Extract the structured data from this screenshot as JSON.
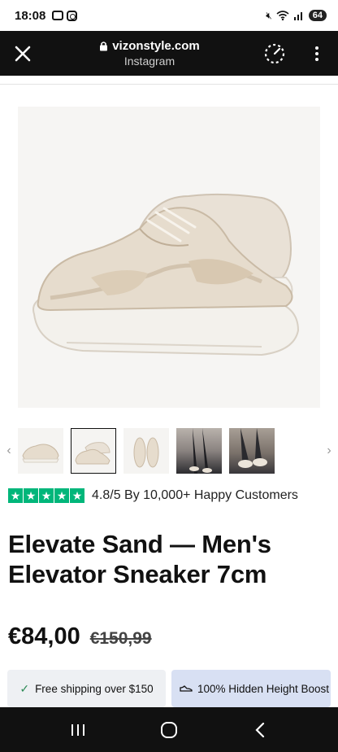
{
  "status_bar": {
    "time": "18:08",
    "battery": "64"
  },
  "browser": {
    "domain": "vizonstyle.com",
    "source": "Instagram"
  },
  "gallery": {
    "thumbnails": [
      {
        "label": "sneaker-side-pair"
      },
      {
        "label": "sneaker-angle-pair"
      },
      {
        "label": "sneaker-top-pair"
      },
      {
        "label": "model-street-photo"
      },
      {
        "label": "model-closeup-photo"
      }
    ],
    "active_index": 1
  },
  "rating": {
    "stars": 5,
    "text": "4.8/5 By 10,000+ Happy Customers",
    "color": "#00b67a"
  },
  "product": {
    "title": "Elevate Sand — Men's Elevator Sneaker 7cm",
    "price": "€84,00",
    "compare_price": "€150,99"
  },
  "badges": {
    "shipping": "Free shipping over $150",
    "height": "100% Hidden Height Boost"
  }
}
